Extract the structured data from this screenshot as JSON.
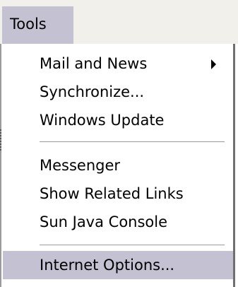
{
  "menu": {
    "title": "Tools",
    "items": [
      {
        "label": "Mail and News",
        "has_submenu": true
      },
      {
        "label": "Synchronize..."
      },
      {
        "label": "Windows Update"
      },
      {
        "label": "Messenger"
      },
      {
        "label": "Show Related Links"
      },
      {
        "label": "Sun Java Console"
      },
      {
        "label": "Internet Options...",
        "highlighted": true
      }
    ]
  },
  "colors": {
    "highlight": "#c4c1d3",
    "menubar": "#f1f0ea",
    "text": "#000000"
  }
}
